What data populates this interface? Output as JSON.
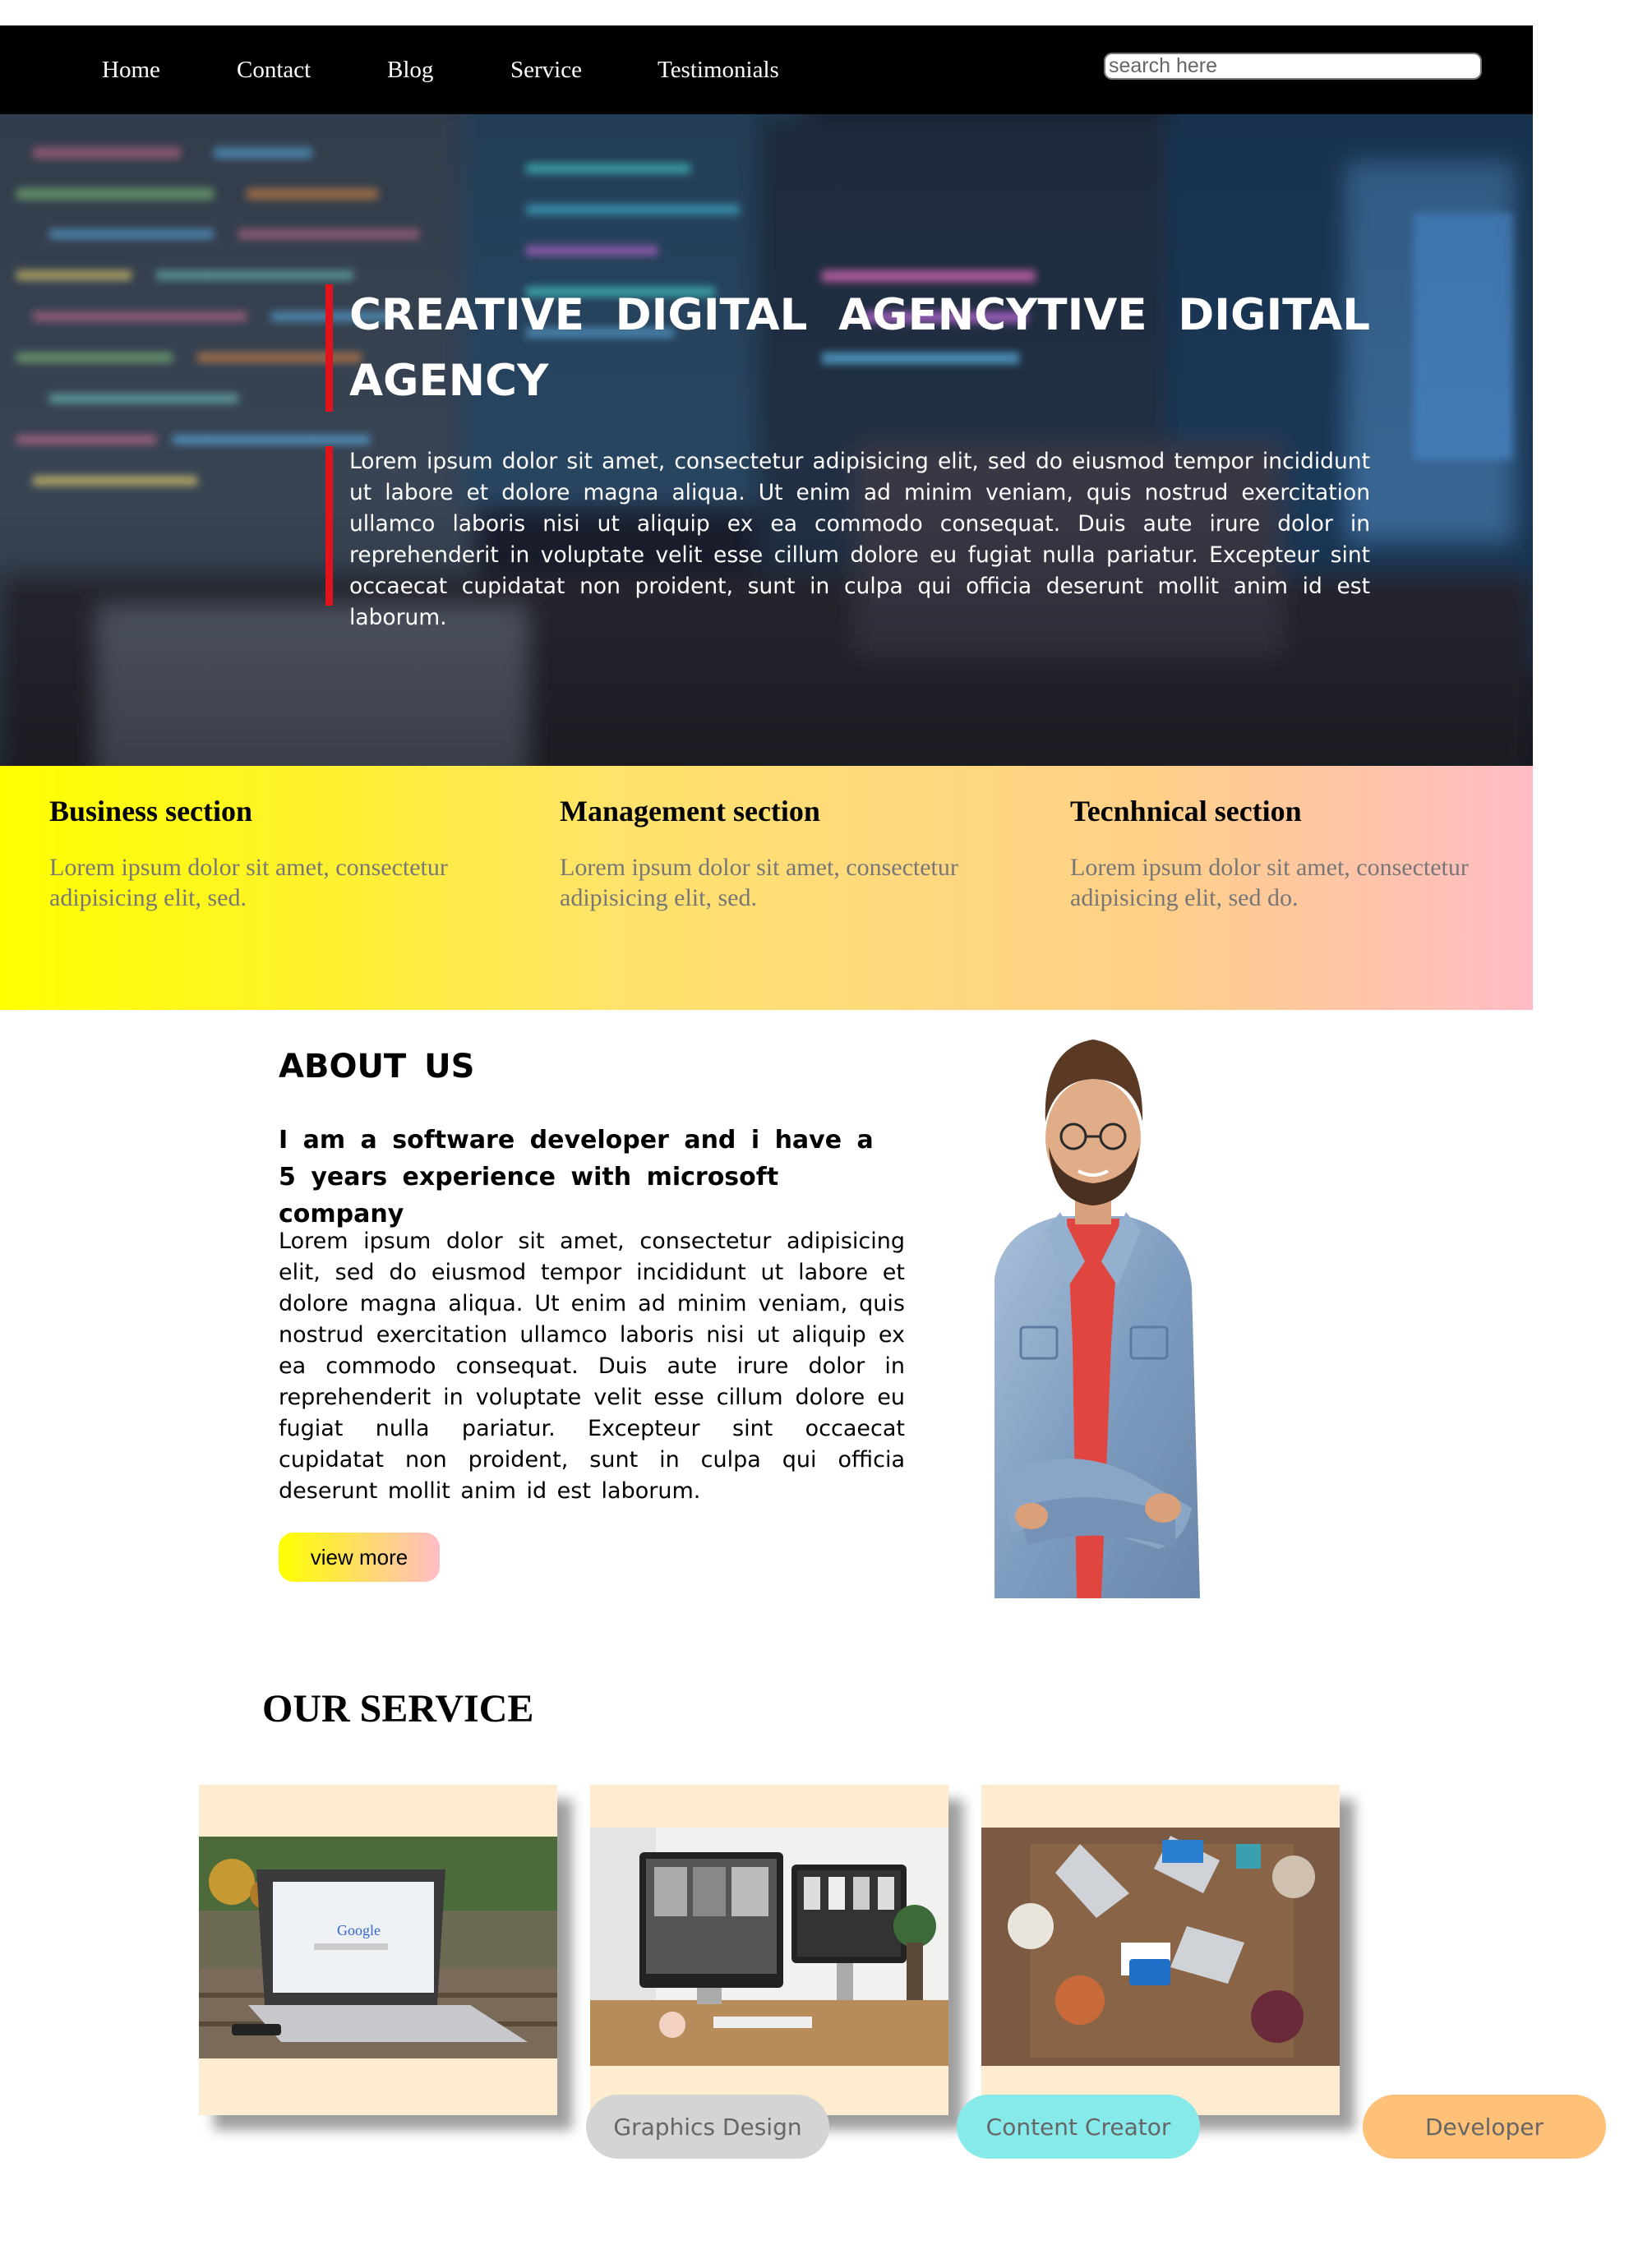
{
  "nav": {
    "items": [
      "Home",
      "Contact",
      "Blog",
      "Service",
      "Testimonials"
    ],
    "search_placeholder": "search here"
  },
  "hero": {
    "title": "CREATIVE DIGITAL AGENCYTIVE DIGITAL AGENCY",
    "text": "Lorem ipsum dolor sit amet, consectetur adipisicing elit, sed do eiusmod tempor incididunt ut labore et dolore magna aliqua. Ut enim ad minim veniam, quis nostrud exercitation ullamco laboris nisi ut aliquip ex ea commodo consequat. Duis aute irure dolor in reprehenderit in voluptate velit esse cillum dolore eu fugiat nulla pariatur. Excepteur sint occaecat cupidatat non proident, sunt in culpa qui officia deserunt mollit anim id est laborum.",
    "accent_color": "#e0131d"
  },
  "sections": [
    {
      "title": "Business section",
      "text": "Lorem ipsum dolor sit amet, consectetur adipisicing elit, sed."
    },
    {
      "title": "Management section",
      "text": "Lorem ipsum dolor sit amet, consectetur adipisicing elit, sed."
    },
    {
      "title": "Tecnhnical section",
      "text": "Lorem ipsum dolor sit amet, consectetur adipisicing elit, sed do."
    }
  ],
  "about": {
    "title": "ABOUT US",
    "subtitle": "I am a software developer and i have a 5 years experience with microsoft company",
    "text": "Lorem ipsum dolor sit amet, consectetur adipisicing elit, sed do eiusmod tempor incididunt ut labore et dolore magna aliqua. Ut enim ad minim veniam, quis nostrud exercitation ullamco laboris nisi ut aliquip ex ea commodo consequat. Duis aute irure dolor in reprehenderit in voluptate velit esse cillum dolore eu fugiat nulla pariatur. Excepteur sint occaecat cupidatat non proident, sunt in culpa qui officia deserunt mollit anim id est laborum.",
    "button_label": "view more"
  },
  "service": {
    "title": "OUR SERVICE",
    "pills": [
      {
        "label": "Graphics Design",
        "color": "#d4d4d4"
      },
      {
        "label": "Content Creator",
        "color": "#87eaea"
      },
      {
        "label": "Developer",
        "color": "#ffc078"
      }
    ]
  }
}
